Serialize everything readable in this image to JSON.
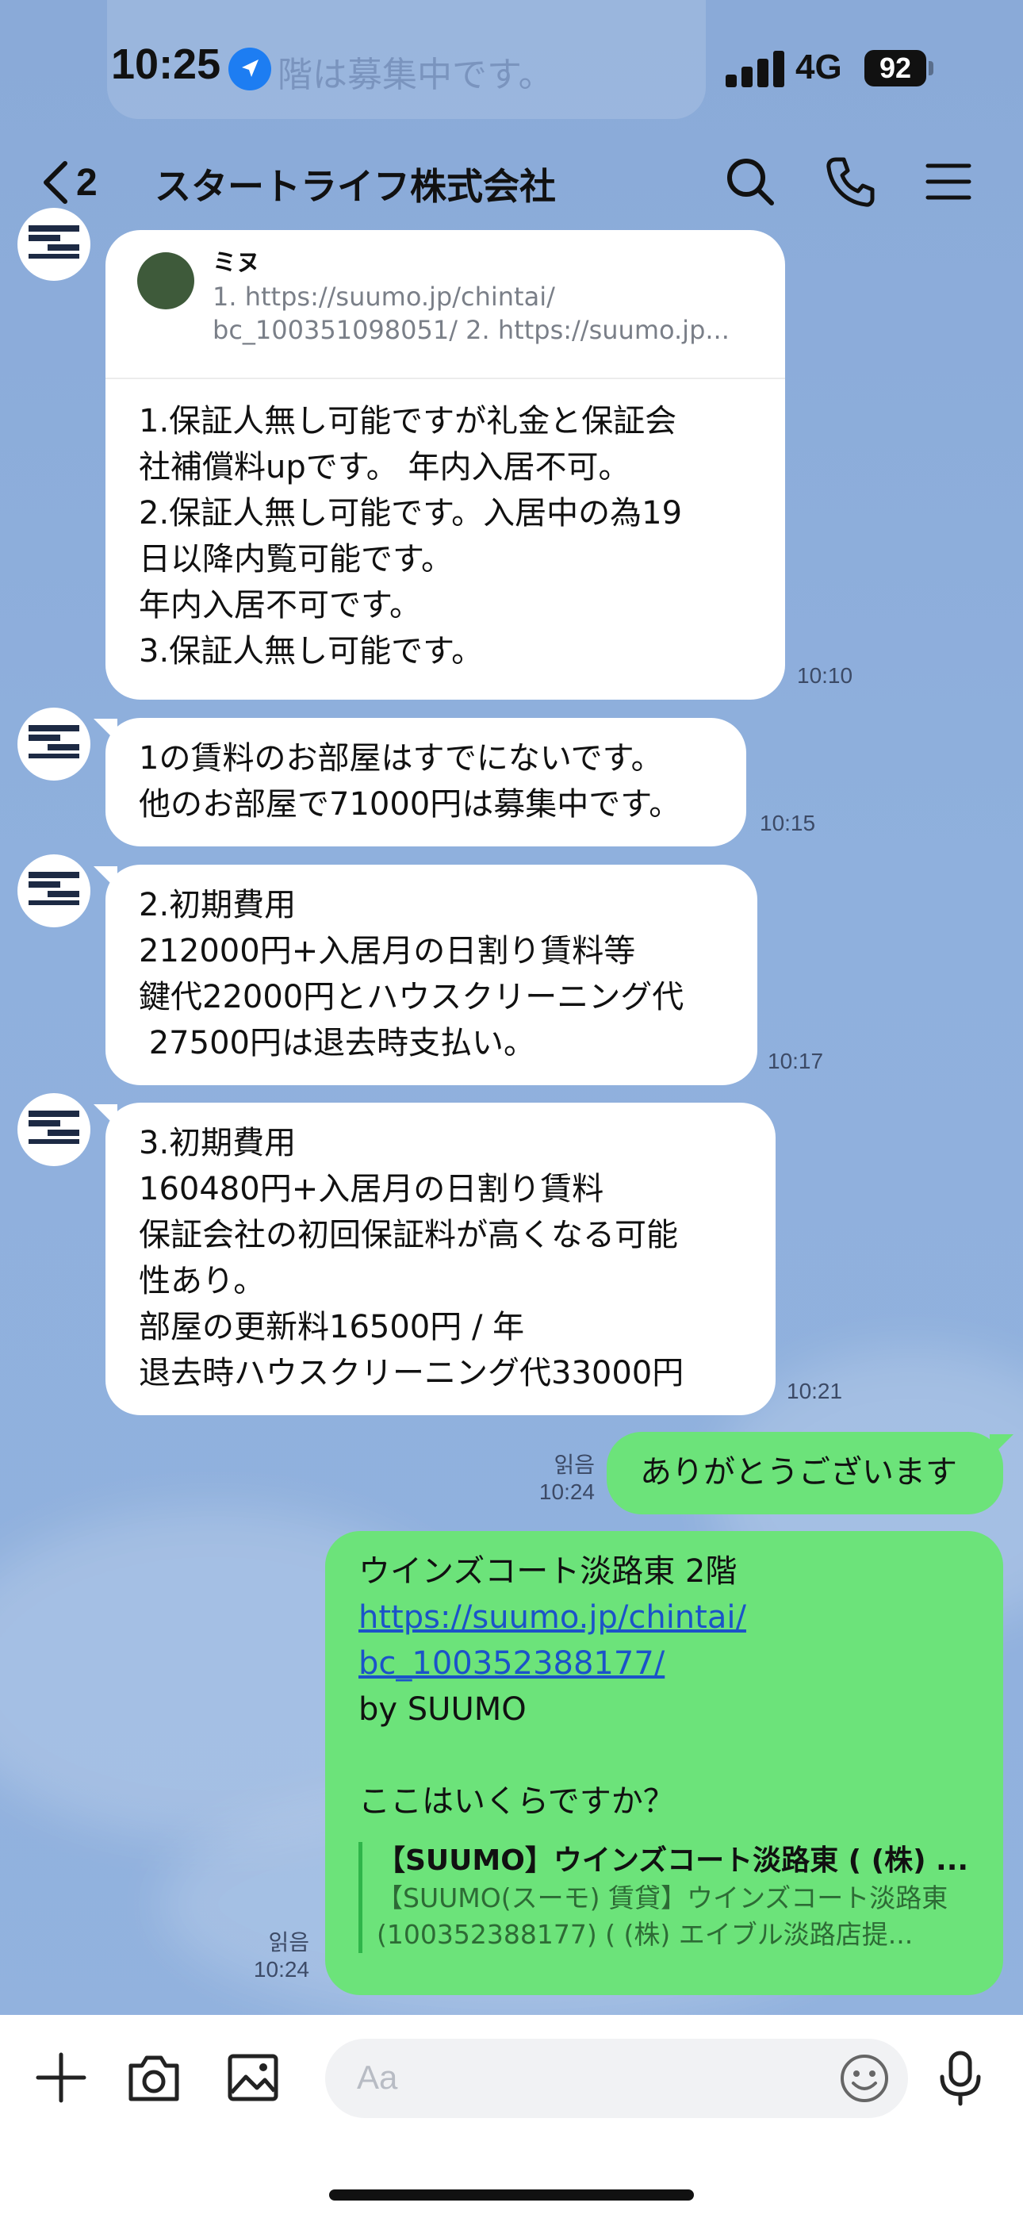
{
  "status_bar": {
    "time": "10:25",
    "network": "4G",
    "battery": "92",
    "ghost_text": "階は募集中です。"
  },
  "header": {
    "back_count": "2",
    "title": "スタートライフ株式会社",
    "icons": [
      "search-icon",
      "phone-icon",
      "menu-icon"
    ]
  },
  "messages": [
    {
      "sender": "agent",
      "quote": {
        "name": "ミヌ",
        "line1": "1. https://suumo.jp/chintai/",
        "line2": "bc_100351098051/ 2. https://suumo.jp..."
      },
      "lines": [
        "1.保証人無し可能ですが礼金と保証会",
        "社補償料upです。 年内入居不可。",
        "2.保証人無し可能です。入居中の為19",
        "日以降内覧可能です。",
        "年内入居不可です。",
        "3.保証人無し可能です。"
      ],
      "time": "10:10"
    },
    {
      "sender": "agent",
      "lines": [
        "1の賃料のお部屋はすでにないです。",
        "他のお部屋で71000円は募集中です。"
      ],
      "time": "10:15"
    },
    {
      "sender": "agent",
      "lines": [
        "2.初期費用",
        "212000円+入居月の日割り賃料等",
        "鍵代22000円とハウスクリーニング代",
        " 27500円は退去時支払い。"
      ],
      "time": "10:17"
    },
    {
      "sender": "agent",
      "lines": [
        "3.初期費用",
        "160480円+入居月の日割り賃料",
        "保証会社の初回保証料が高くなる可能",
        "性あり。",
        "部屋の更新料16500円 / 年",
        "退去時ハウスクリーニング代33000円"
      ],
      "time": "10:21"
    },
    {
      "sender": "me",
      "read": "읽음",
      "time": "10:24",
      "lines": [
        "ありがとうございます"
      ]
    },
    {
      "sender": "me",
      "read": "읽음",
      "time": "10:24",
      "line1": "ウインズコート淡路東 2階",
      "link1": "https://suumo.jp/chintai/",
      "link2": "bc_100352388177/",
      "by": "by SUUMO",
      "question": "ここはいくらですか？",
      "preview_title": "【SUUMO】ウインズコート淡路東 ( (株) ...",
      "preview_line1": "【SUUMO(スーモ) 賃貸】ウインズコート淡路東",
      "preview_line2": "(100352388177) ( (株) エイブル淡路店提..."
    }
  ],
  "input_bar": {
    "placeholder": "Aa",
    "icons": [
      "plus-icon",
      "camera-icon",
      "image-icon",
      "emoji-icon",
      "mic-icon"
    ]
  },
  "colors": {
    "background": "#8eaedb",
    "my_bubble": "#6ce37a",
    "their_bubble": "#ffffff",
    "link": "#1b53c9"
  }
}
